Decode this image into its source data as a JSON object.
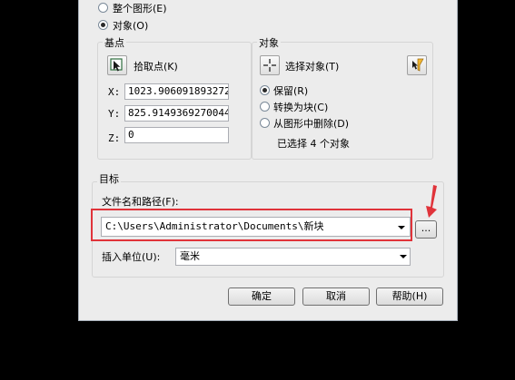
{
  "top_options": {
    "entire_drawing": "整个图形(E)",
    "objects": "对象(O)"
  },
  "base_point": {
    "title": "基点",
    "pick_point_label": "拾取点(K)",
    "x_label": "X:",
    "x_value": "1023.906091893272",
    "y_label": "Y:",
    "y_value": "825.9149369270044",
    "z_label": "Z:",
    "z_value": "0"
  },
  "objects_group": {
    "title": "对象",
    "select_objects_label": "选择对象(T)",
    "retain": "保留(R)",
    "convert_to_block": "转换为块(C)",
    "delete_from_drawing": "从图形中删除(D)",
    "selected_count": "已选择 4 个对象"
  },
  "destination": {
    "title": "目标",
    "file_path_label": "文件名和路径(F):",
    "file_path_value": "C:\\Users\\Administrator\\Documents\\新块",
    "browse_label": "...",
    "insert_units_label": "插入单位(U):",
    "insert_units_value": "毫米"
  },
  "buttons": {
    "ok": "确定",
    "cancel": "取消",
    "help": "帮助(H)"
  },
  "colors": {
    "highlight_box": "#e0333a",
    "annotation_arrow": "#e0333a"
  }
}
